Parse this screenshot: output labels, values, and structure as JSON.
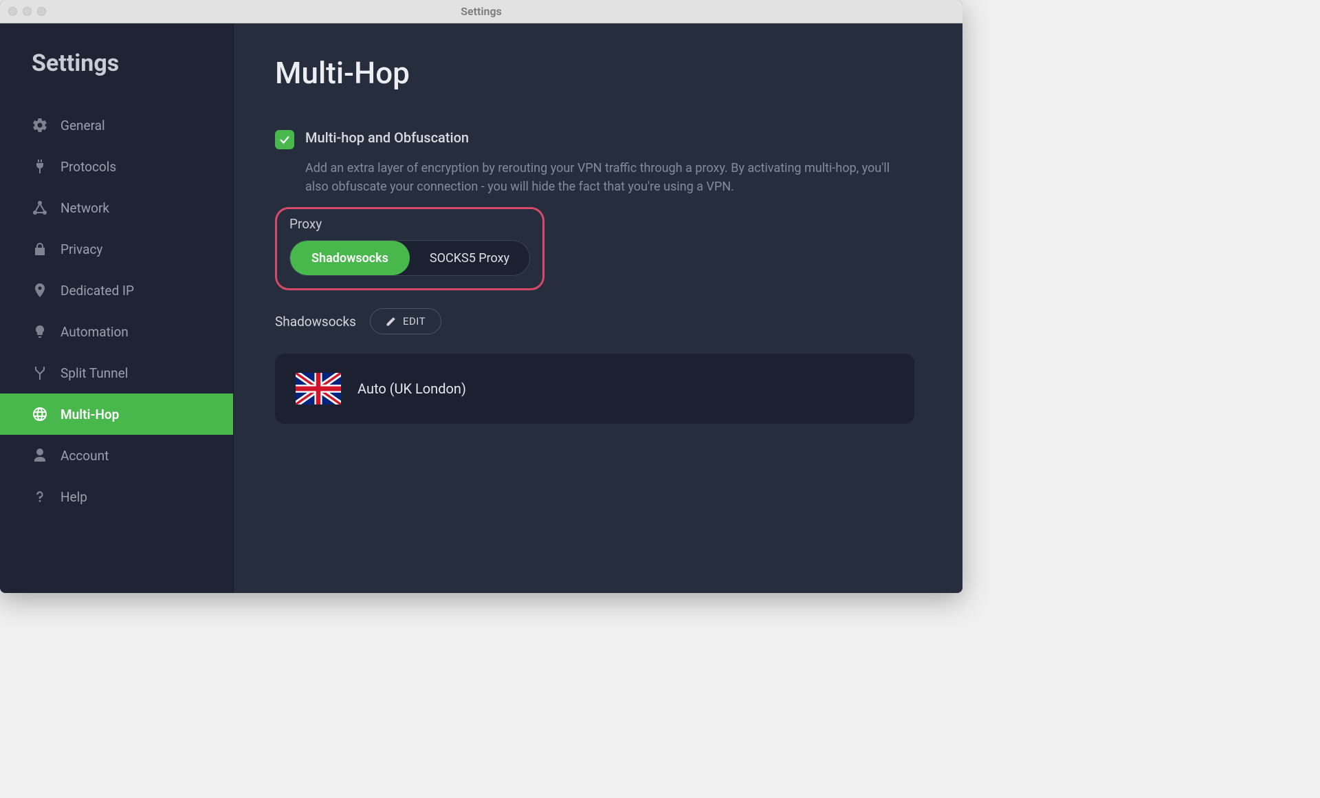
{
  "window": {
    "title": "Settings"
  },
  "sidebar": {
    "heading": "Settings",
    "items": [
      {
        "label": "General"
      },
      {
        "label": "Protocols"
      },
      {
        "label": "Network"
      },
      {
        "label": "Privacy"
      },
      {
        "label": "Dedicated IP"
      },
      {
        "label": "Automation"
      },
      {
        "label": "Split Tunnel"
      },
      {
        "label": "Multi-Hop"
      },
      {
        "label": "Account"
      },
      {
        "label": "Help"
      }
    ]
  },
  "page": {
    "title": "Multi-Hop",
    "option": {
      "label": "Multi-hop and Obfuscation",
      "description": "Add an extra layer of encryption by rerouting your VPN traffic through a proxy. By activating multi-hop, you'll also obfuscate your connection - you will hide the fact that you're using a VPN."
    },
    "proxy": {
      "label": "Proxy",
      "option_a": "Shadowsocks",
      "option_b": "SOCKS5 Proxy"
    },
    "shadowsocks": {
      "label": "Shadowsocks",
      "edit": "EDIT"
    },
    "server": {
      "name": "Auto (UK London)"
    }
  }
}
